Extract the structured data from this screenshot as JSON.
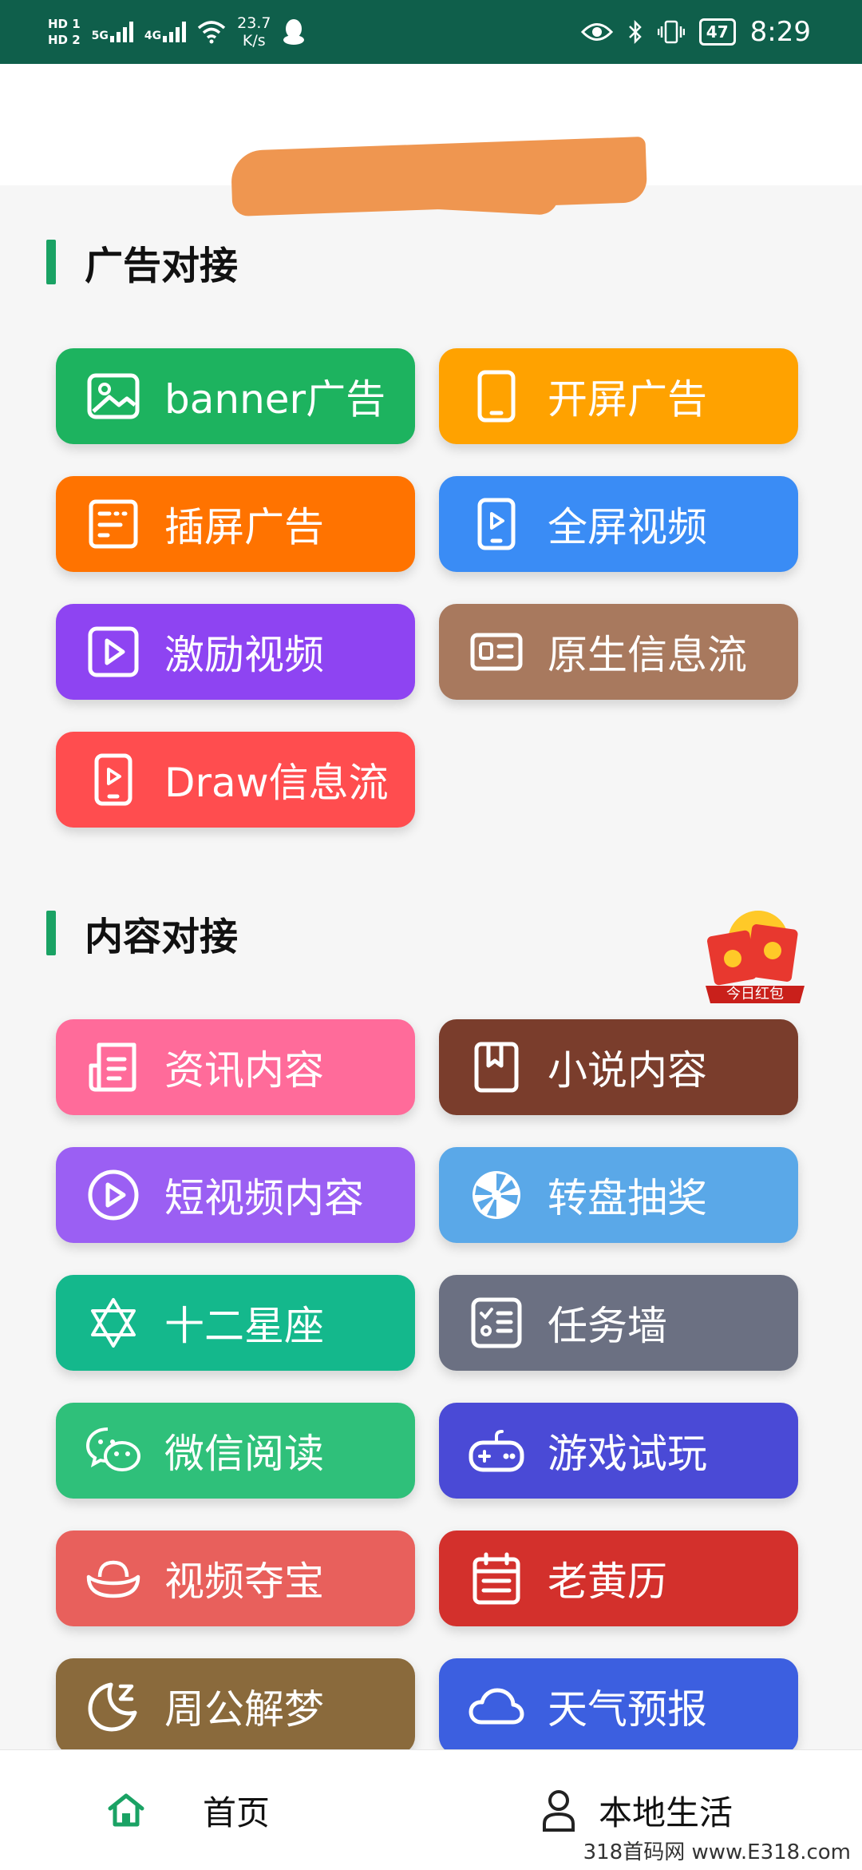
{
  "status_bar": {
    "hd1": "HD 1",
    "hd2": "HD 2",
    "net1": "5G",
    "net2": "4G",
    "speed_value": "23.7",
    "speed_unit": "K/s",
    "battery": "47",
    "time": "8:29"
  },
  "sections": {
    "ads": {
      "title": "广告对接",
      "buttons": [
        {
          "label": "banner广告",
          "color": "#1db35f",
          "icon": "image-icon"
        },
        {
          "label": "开屏广告",
          "color": "#ffa200",
          "icon": "phone-icon"
        },
        {
          "label": "插屏广告",
          "color": "#ff7300",
          "icon": "window-icon"
        },
        {
          "label": "全屏视频",
          "color": "#3a8cf5",
          "icon": "phone-play-icon"
        },
        {
          "label": "激励视频",
          "color": "#8e44f2",
          "icon": "play-square-icon"
        },
        {
          "label": "原生信息流",
          "color": "#a8795e",
          "icon": "card-icon"
        },
        {
          "label": "Draw信息流",
          "color": "#ff4d4f",
          "icon": "phone-play-icon"
        }
      ]
    },
    "content": {
      "title": "内容对接",
      "badge_text": "今日红包",
      "buttons": [
        {
          "label": "资讯内容",
          "color": "#ff6b9a",
          "icon": "news-icon"
        },
        {
          "label": "小说内容",
          "color": "#7a3d2c",
          "icon": "book-icon"
        },
        {
          "label": "短视频内容",
          "color": "#9b5ff3",
          "icon": "play-circle-icon"
        },
        {
          "label": "转盘抽奖",
          "color": "#5aa8e8",
          "icon": "wheel-icon"
        },
        {
          "label": "十二星座",
          "color": "#14b88c",
          "icon": "star-of-david-icon"
        },
        {
          "label": "任务墙",
          "color": "#6b7082",
          "icon": "checklist-icon"
        },
        {
          "label": "微信阅读",
          "color": "#2fc07a",
          "icon": "wechat-icon"
        },
        {
          "label": "游戏试玩",
          "color": "#4a4ad6",
          "icon": "gamepad-icon"
        },
        {
          "label": "视频夺宝",
          "color": "#e8605c",
          "icon": "ingot-icon"
        },
        {
          "label": "老黄历",
          "color": "#d3302c",
          "icon": "calendar-icon"
        },
        {
          "label": "周公解梦",
          "color": "#8a6a3c",
          "icon": "moon-icon"
        },
        {
          "label": "天气预报",
          "color": "#3c5fe0",
          "icon": "cloud-icon"
        }
      ]
    }
  },
  "bottom_nav": {
    "home": "首页",
    "local": "本地生活"
  },
  "watermark": "318首码网 www.E318.com"
}
